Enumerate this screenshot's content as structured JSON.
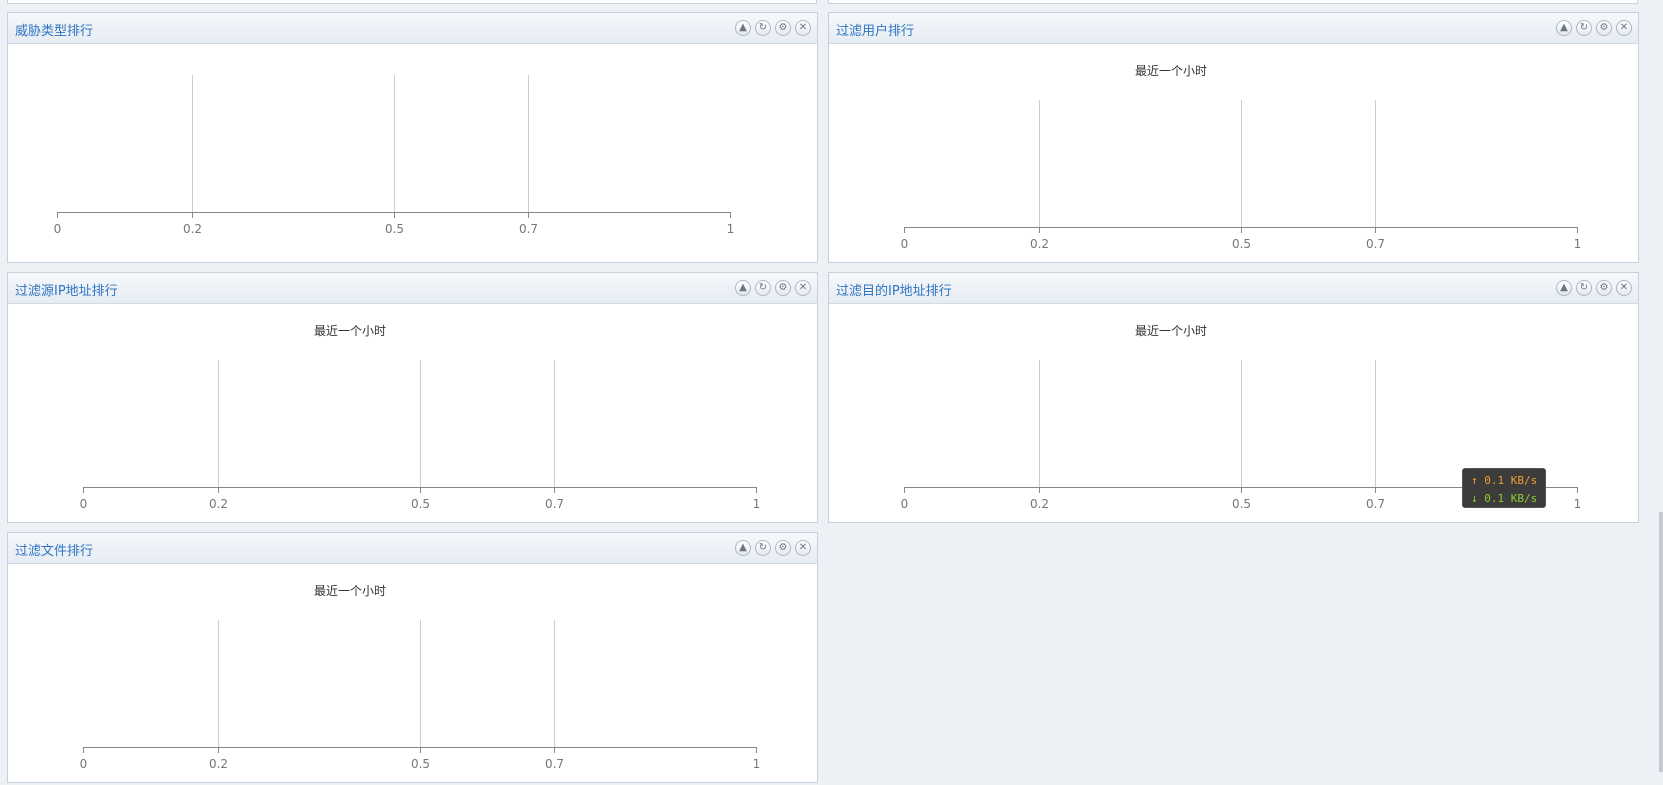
{
  "panels": [
    {
      "title": "威胁类型排行",
      "caption": "",
      "tools": [
        "collapse-icon",
        "refresh-icon",
        "gear-icon",
        "close-icon"
      ]
    },
    {
      "title": "过滤用户排行",
      "caption": "最近一个小时",
      "tools": [
        "collapse-icon",
        "refresh-icon",
        "gear-icon",
        "close-icon"
      ]
    },
    {
      "title": "过滤源IP地址排行",
      "caption": "最近一个小时",
      "tools": [
        "collapse-icon",
        "refresh-icon",
        "gear-icon",
        "close-icon"
      ]
    },
    {
      "title": "过滤目的IP地址排行",
      "caption": "最近一个小时",
      "tools": [
        "collapse-icon",
        "refresh-icon",
        "gear-icon",
        "close-icon"
      ]
    },
    {
      "title": "过滤文件排行",
      "caption": "最近一个小时",
      "tools": [
        "collapse-icon",
        "refresh-icon",
        "gear-icon",
        "close-icon"
      ]
    }
  ],
  "chart_data": [
    {
      "type": "bar",
      "orientation": "horizontal",
      "categories": [],
      "values": [],
      "xlim": [
        0,
        1
      ],
      "xticks": [
        0,
        0.2,
        0.5,
        0.7,
        1
      ],
      "xtick_labels": [
        "0",
        "0.2",
        "0.5",
        "0.7",
        "1"
      ],
      "grid": true
    },
    {
      "type": "bar",
      "orientation": "horizontal",
      "categories": [],
      "values": [],
      "title": "最近一个小时",
      "xlim": [
        0,
        1
      ],
      "xticks": [
        0,
        0.2,
        0.5,
        0.7,
        1
      ],
      "xtick_labels": [
        "0",
        "0.2",
        "0.5",
        "0.7",
        "1"
      ],
      "grid": true
    },
    {
      "type": "bar",
      "orientation": "horizontal",
      "categories": [],
      "values": [],
      "title": "最近一个小时",
      "xlim": [
        0,
        1
      ],
      "xticks": [
        0,
        0.2,
        0.5,
        0.7,
        1
      ],
      "xtick_labels": [
        "0",
        "0.2",
        "0.5",
        "0.7",
        "1"
      ],
      "grid": true
    },
    {
      "type": "bar",
      "orientation": "horizontal",
      "categories": [],
      "values": [],
      "title": "最近一个小时",
      "xlim": [
        0,
        1
      ],
      "xticks": [
        0,
        0.2,
        0.5,
        0.7,
        1
      ],
      "xtick_labels": [
        "0",
        "0.2",
        "0.5",
        "0.7",
        "1"
      ],
      "grid": true
    },
    {
      "type": "bar",
      "orientation": "horizontal",
      "categories": [],
      "values": [],
      "title": "最近一个小时",
      "xlim": [
        0,
        1
      ],
      "xticks": [
        0,
        0.2,
        0.5,
        0.7,
        1
      ],
      "xtick_labels": [
        "0",
        "0.2",
        "0.5",
        "0.7",
        "1"
      ],
      "grid": true
    }
  ],
  "traffic_tooltip": {
    "up_arrow": "↑",
    "up": "0.1 KB/s",
    "down_arrow": "↓",
    "down": "0.1 KB/s",
    "up_color": "#f0a030",
    "down_color": "#8ccf2a"
  },
  "colors": {
    "title": "#2e74c1",
    "background": "#edf0f5",
    "axis": "#888888",
    "grid": "#cccccc"
  }
}
